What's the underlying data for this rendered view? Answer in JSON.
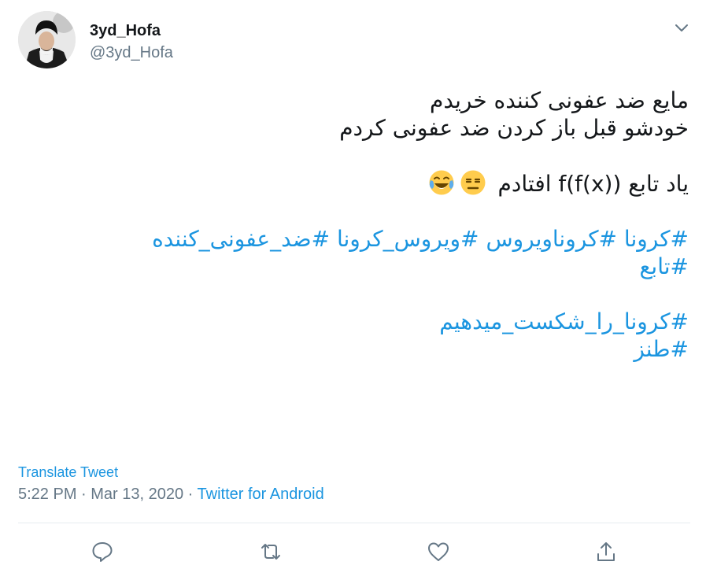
{
  "author": {
    "display_name": "3yd_Hofa",
    "handle": "@3yd_Hofa"
  },
  "tweet": {
    "line1": "مایع ضد عفونی کننده خریدم",
    "line2": "خودشو قبل باز کردن ضد عفونی کردم",
    "line3": "یاد تابع f(f(x)) افتادم",
    "hashtags_row1": [
      "#کرونا",
      "#کروناویروس",
      "#ویروس_کرونا",
      "#ضد_عفونی_کننده"
    ],
    "hashtags_row2": [
      "#تابع"
    ],
    "hashtags_row3": [
      "#کرونا_را_شکست_میدهیم"
    ],
    "hashtags_row4": [
      "#طنز"
    ]
  },
  "translate_label": "Translate Tweet",
  "meta": {
    "time": "5:22 PM",
    "separator": " · ",
    "date": "Mar 13, 2020",
    "source": "Twitter for Android"
  },
  "colors": {
    "link": "#1b95e0",
    "text": "#14171a",
    "muted": "#657786",
    "divider": "#e6ecf0"
  },
  "icons": [
    "chevron-down-icon",
    "expressionless-emoji",
    "laughing-tears-emoji",
    "reply-icon",
    "retweet-icon",
    "like-icon",
    "share-icon"
  ]
}
